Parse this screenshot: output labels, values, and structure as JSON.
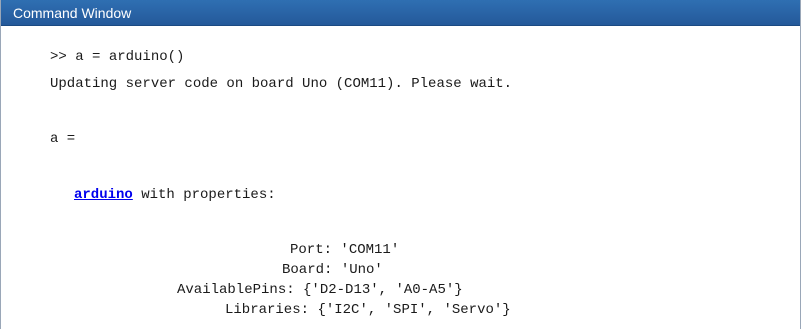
{
  "window": {
    "title": "Command Window"
  },
  "console": {
    "prompt": ">> ",
    "command": "a = arduino()",
    "message": "Updating server code on board Uno (COM11). Please wait.",
    "var_line": "a =",
    "object_class_link": "arduino",
    "with_properties": " with properties:",
    "properties": [
      {
        "key": "Port",
        "value": "'COM11'"
      },
      {
        "key": "Board",
        "value": "'Uno'"
      },
      {
        "key": "AvailablePins",
        "value": "{'D2-D13', 'A0-A5'}"
      },
      {
        "key": "Libraries",
        "value": "{'I2C', 'SPI', 'Servo'}"
      }
    ]
  }
}
